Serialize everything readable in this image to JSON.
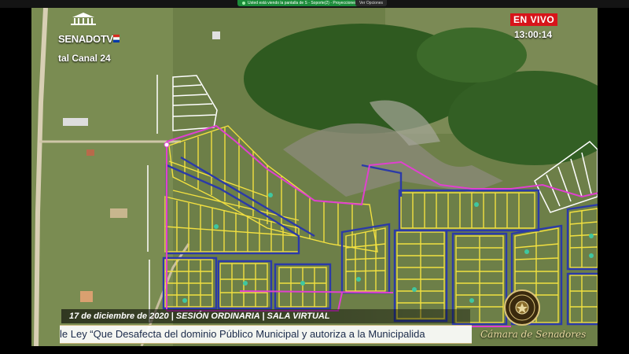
{
  "top_bar": {
    "share_text": "Usted está viendo la pantalla de S - Soporte(2) - Proyecciones",
    "view_options": "Ver Opciones"
  },
  "branding": {
    "logo_text": "SENADO",
    "logo_tv": "TV",
    "channel_text": "tal Canal 24"
  },
  "live": {
    "label": "EN VIVO",
    "time": "13:00:14"
  },
  "lower_third": {
    "info_line": "17 de diciembre de 2020  |  SESIÓN ORDINARIA  |  SALA VIRTUAL",
    "ticker": "le Ley “Que Desafecta del dominio Público Municipal y autoriza a la Municipalida",
    "chamber": "Cámara de Senadores"
  },
  "colors": {
    "live_red": "#d7141a",
    "lot_yellow": "#f2e040",
    "block_blue": "#2b3aa8",
    "boundary_magenta": "#e040d0",
    "lot_white": "#ffffff"
  }
}
